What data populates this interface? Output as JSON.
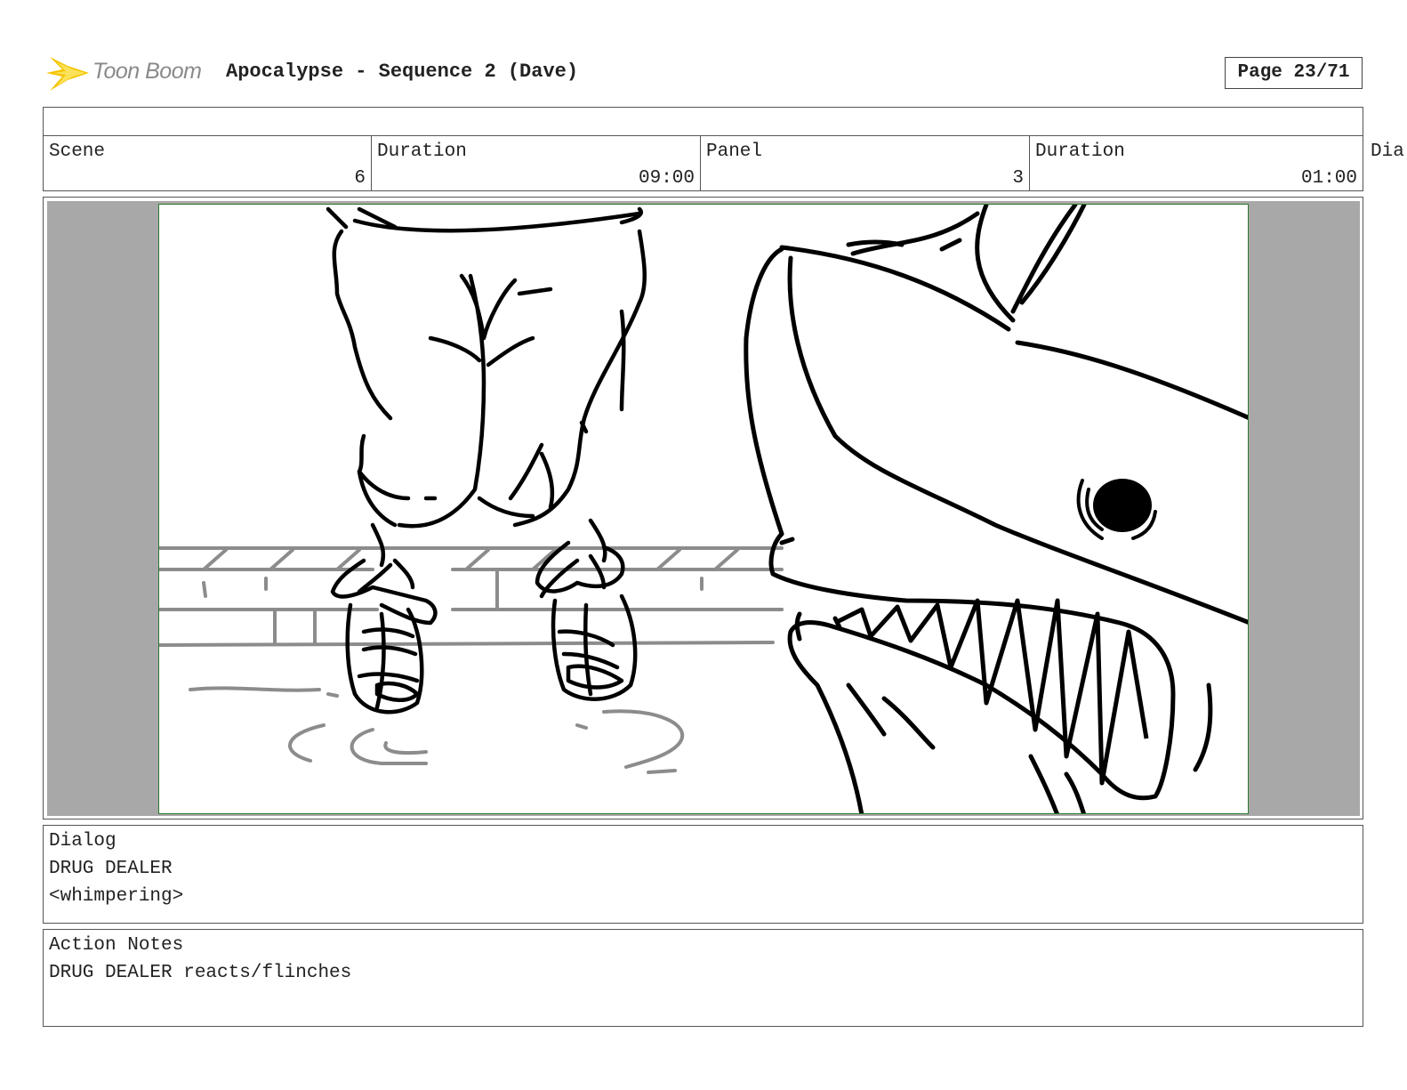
{
  "header": {
    "logo_text": "Toon Boom",
    "title": "Apocalypse - Sequence 2 (Dave)",
    "page": "Page 23/71"
  },
  "info": {
    "scene_label": "Scene",
    "scene_value": "6",
    "scene_duration_label": "Duration",
    "scene_duration_value": "09:00",
    "panel_label": "Panel",
    "panel_value": "3",
    "panel_duration_label": "Duration",
    "panel_duration_value": "01:00",
    "dialog_col_label": "Dia"
  },
  "colors": {
    "frame_border": "#2f7a2f",
    "frame_background": "#a8a8a8",
    "logo_star": "#f5c400"
  },
  "dialog": {
    "label": "Dialog",
    "line1": "DRUG DEALER",
    "line2": "<whimpering>"
  },
  "action": {
    "label": "Action Notes",
    "line1": "DRUG DEALER reacts/flinches"
  }
}
